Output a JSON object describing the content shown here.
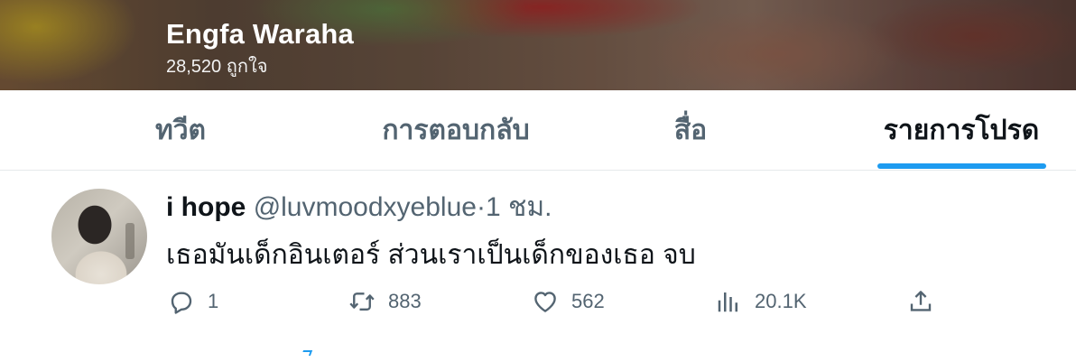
{
  "header": {
    "name": "Engfa Waraha",
    "likes_count": "28,520",
    "likes_label": "ถูกใจ"
  },
  "tabs": [
    {
      "label": "ทวีต",
      "active": false
    },
    {
      "label": "การตอบกลับ",
      "active": false
    },
    {
      "label": "สื่อ",
      "active": false
    },
    {
      "label": "รายการโปรด",
      "active": true
    }
  ],
  "tweet": {
    "author_name": "i hope",
    "handle": "@luvmoodxyeblue",
    "separator": "·",
    "time": "1 ชม.",
    "text": "เธอมันเด็กอินเตอร์ ส่วนเราเป็นเด็กของเธอ จบ",
    "actions": {
      "reply": {
        "icon": "reply-icon",
        "count": "1"
      },
      "retweet": {
        "icon": "retweet-icon",
        "count": "883"
      },
      "like": {
        "icon": "heart-icon",
        "count": "562"
      },
      "views": {
        "icon": "views-chart-icon",
        "count": "20.1K"
      },
      "share": {
        "icon": "share-icon"
      }
    }
  },
  "colors": {
    "accent": "#1d9bf0",
    "text_primary": "#0f1419",
    "text_secondary": "#536471"
  }
}
